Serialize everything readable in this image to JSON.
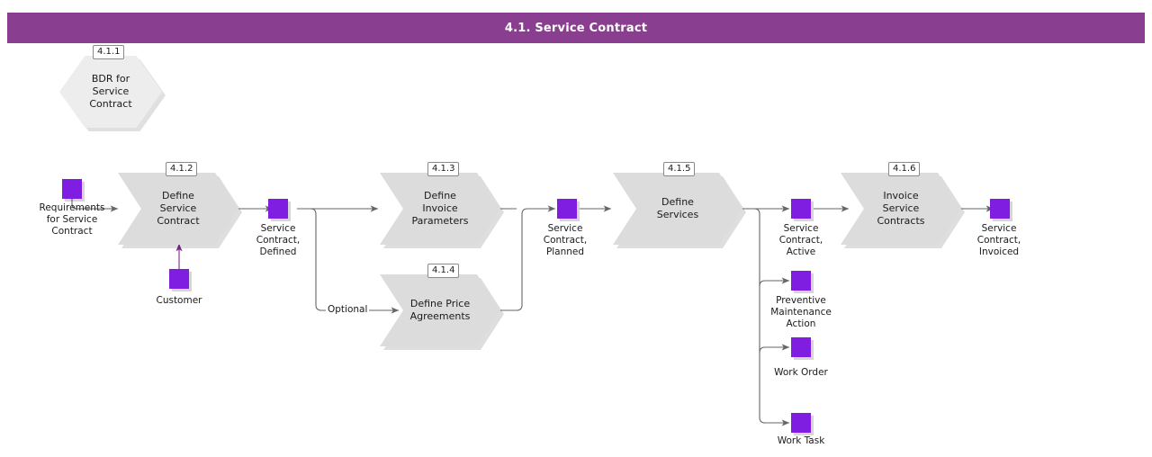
{
  "header": {
    "title": "4.1. Service Contract",
    "bar_color": "#8A3E90"
  },
  "palette": {
    "object_purple": "#7F1DE0",
    "process_gray": "#DCDCDC",
    "hexagon_gray": "#EDEDED",
    "connector_gray": "#666666"
  },
  "processes": [
    {
      "id": "4.1.1",
      "label": "BDR for\nService\nContract",
      "shape": "hexagon"
    },
    {
      "id": "4.1.2",
      "label": "Define Service\nContract",
      "shape": "chevron"
    },
    {
      "id": "4.1.3",
      "label": "Define Invoice\nParameters",
      "shape": "chevron"
    },
    {
      "id": "4.1.4",
      "label": "Define Price\nAgreements",
      "shape": "chevron"
    },
    {
      "id": "4.1.5",
      "label": "Define Services",
      "shape": "chevron"
    },
    {
      "id": "4.1.6",
      "label": "Invoice Service\nContracts",
      "shape": "chevron"
    }
  ],
  "objects": [
    {
      "name": "requirements-for-service-contract",
      "label": "Requirements\nfor Service\nContract"
    },
    {
      "name": "customer",
      "label": "Customer"
    },
    {
      "name": "service-contract-defined",
      "label": "Service\nContract,\nDefined"
    },
    {
      "name": "service-contract-planned",
      "label": "Service\nContract,\nPlanned"
    },
    {
      "name": "service-contract-active",
      "label": "Service\nContract,\nActive"
    },
    {
      "name": "preventive-maintenance-action",
      "label": "Preventive\nMaintenance\nAction"
    },
    {
      "name": "work-order",
      "label": "Work Order"
    },
    {
      "name": "work-task",
      "label": "Work Task"
    },
    {
      "name": "service-contract-invoiced",
      "label": "Service\nContract,\nInvoiced"
    }
  ],
  "edges": [
    {
      "name": "optional-branch",
      "label": "Optional"
    }
  ]
}
